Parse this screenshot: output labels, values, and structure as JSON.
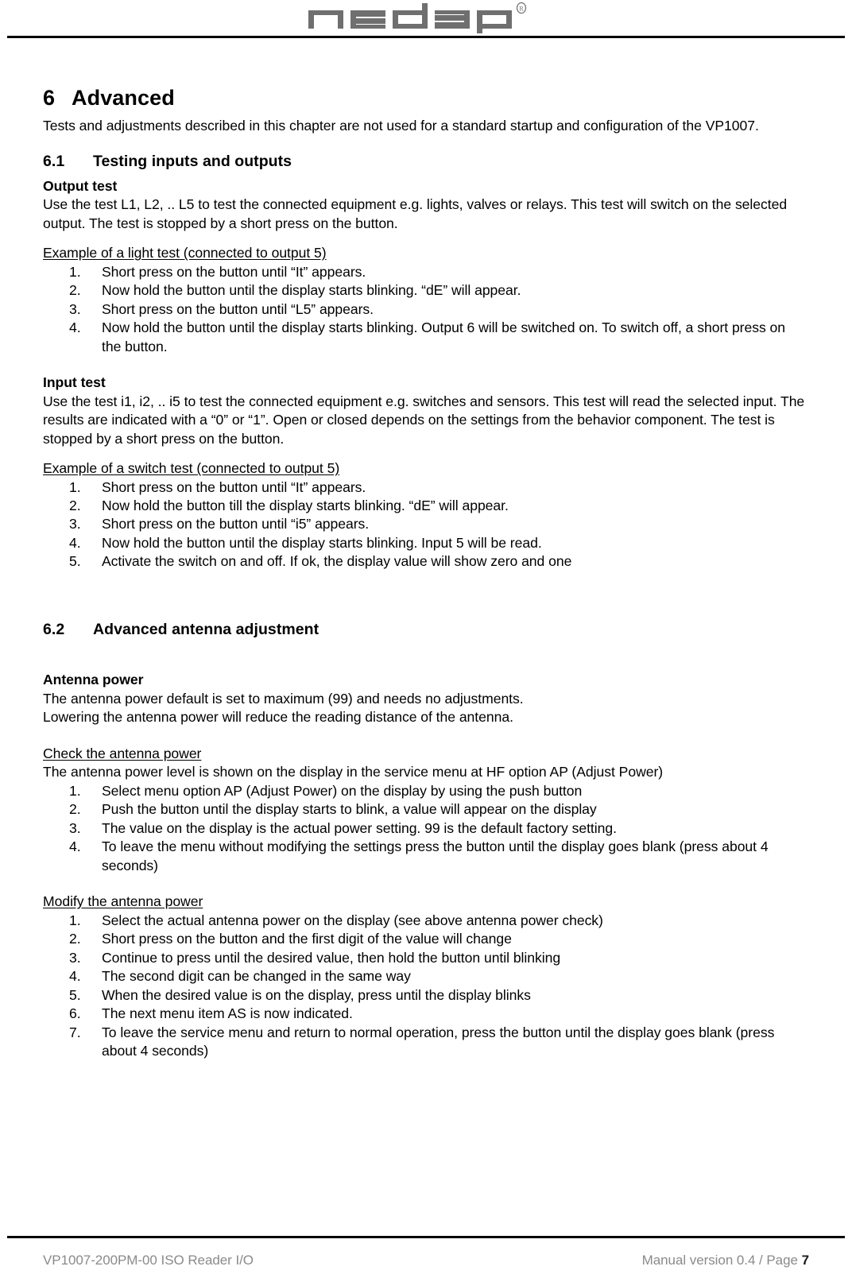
{
  "header": {
    "logo_text": "nedap",
    "logo_trademark": "®"
  },
  "chapter": {
    "number": "6",
    "title": "Advanced",
    "intro": "Tests and adjustments described in this chapter are not used for a standard startup and configuration of the VP1007."
  },
  "sections": [
    {
      "number": "6.1",
      "title": "Testing inputs and outputs",
      "output_test": {
        "heading": "Output test",
        "body": "Use the test L1, L2, .. L5 to test the connected equipment e.g. lights, valves or relays. This test will switch on the selected output. The test is stopped by a short press on the button.",
        "example_heading": "Example of a light test (connected to output 5)",
        "steps": [
          "Short press on the button until “It” appears.",
          "Now hold the button until the display starts blinking. “dE” will appear.",
          "Short press on the button until “L5” appears.",
          "Now hold the button until the display starts blinking. Output 6 will be switched on. To switch off, a short press on the button."
        ]
      },
      "input_test": {
        "heading": "Input test",
        "body": "Use the test i1, i2, .. i5 to test the connected equipment e.g. switches and sensors. This test will read the selected input. The results are indicated with a “0” or “1”. Open or closed depends on the settings from the behavior component. The test is stopped by a short press on the button.",
        "example_heading": "Example of a switch test (connected to output 5)",
        "steps": [
          "Short press on the button until “It” appears.",
          "Now hold the button till the display starts blinking. “dE” will appear.",
          "Short press on the button until “i5” appears.",
          "Now hold the button until the display starts blinking. Input 5 will be read.",
          "Activate the switch on and off. If ok, the display value will show zero and one"
        ]
      }
    },
    {
      "number": "6.2",
      "title": "Advanced antenna adjustment",
      "antenna_power": {
        "heading": "Antenna power",
        "body_line_1": "The antenna power default is set to maximum (99) and needs no adjustments.",
        "body_line_2": "Lowering the antenna power will reduce the reading distance of the antenna."
      },
      "check_power": {
        "heading": "Check the antenna power",
        "body": "The antenna power level is shown on the display in the service menu at HF option AP (Adjust Power)",
        "steps": [
          "Select menu option AP (Adjust Power) on the display by using the push button",
          "Push the button until the display starts to blink, a value will appear on the display",
          "The value on the display is the actual power setting. 99 is the default factory setting.",
          "To leave the menu without modifying the settings press the button until the display goes blank (press about 4 seconds)"
        ]
      },
      "modify_power": {
        "heading": "Modify the antenna power",
        "steps": [
          "Select the actual antenna power on the display (see above antenna power check)",
          "Short press on the button and the first digit of the value will change",
          "Continue to press until the desired value, then hold the button until blinking",
          "The second digit can be changed in the same way",
          "When the desired value is on the display, press until the display blinks",
          "The next menu item AS is now indicated.",
          "To leave the service menu and return to normal operation, press the button until the display goes blank (press about 4 seconds)"
        ]
      }
    }
  ],
  "footer": {
    "left": "VP1007-200PM-00 ISO Reader I/O",
    "right_prefix": "Manual version 0.4 / Page",
    "page_number": "7"
  },
  "colors": {
    "logo_gray": "#6f6f6f",
    "footer_gray": "#8a8a8a",
    "rule_black": "#000000",
    "text_black": "#000000"
  }
}
